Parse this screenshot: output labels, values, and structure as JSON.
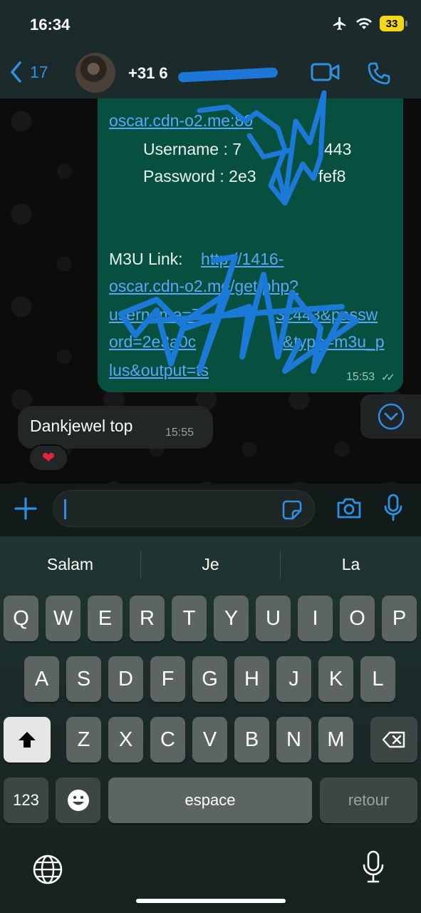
{
  "status_bar": {
    "time": "16:34",
    "battery": "33"
  },
  "header": {
    "back_count": "17",
    "contact_name": "+31 6"
  },
  "messages": {
    "outgoing": {
      "lines": [
        "oscar.cdn-o2.me:80",
        "Username : 7",
        "443",
        "Password : 2e3",
        "fef8",
        "M3U Link: ",
        "http://1416-",
        "oscar.cdn-o2.me/get.php?",
        "username=7",
        "3c443&passw",
        "ord=2e3a0c",
        "&type=m3u_p",
        "lus&output=ts"
      ],
      "time": "15:53"
    },
    "incoming": {
      "text": "Dankjewel top",
      "time": "15:55",
      "reaction": "❤"
    }
  },
  "composer": {
    "placeholder": ""
  },
  "keyboard": {
    "suggestions": [
      "Salam",
      "Je",
      "La"
    ],
    "row1": [
      "Q",
      "W",
      "E",
      "R",
      "T",
      "Y",
      "U",
      "I",
      "O",
      "P"
    ],
    "row2": [
      "A",
      "S",
      "D",
      "F",
      "G",
      "H",
      "J",
      "K",
      "L"
    ],
    "row3": [
      "Z",
      "X",
      "C",
      "V",
      "B",
      "N",
      "M"
    ],
    "numbers_key": "123",
    "space_key": "espace",
    "return_key": "retour"
  },
  "colors": {
    "accent": "#2f8fe0",
    "outgoing_bubble": "#07503f",
    "incoming_bubble": "#232626",
    "link": "#57a7ff"
  }
}
